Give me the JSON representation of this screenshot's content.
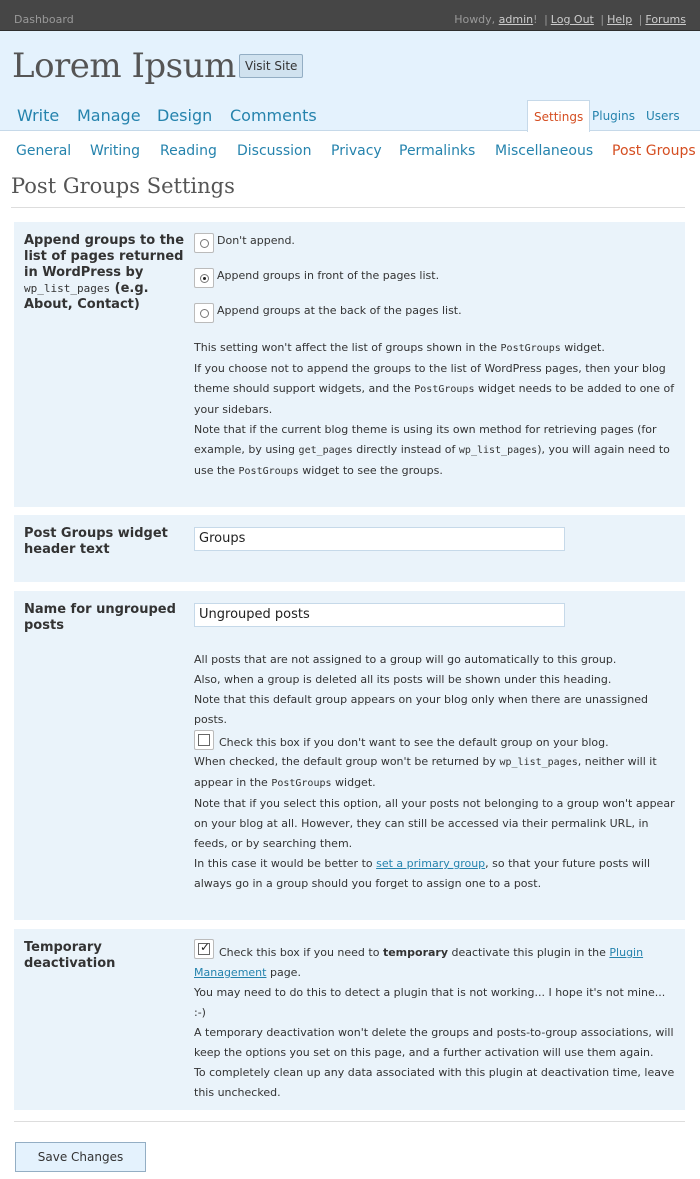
{
  "topbar": {
    "dashboard": "Dashboard",
    "howdy": "Howdy, ",
    "user": "admin",
    "bang": "!",
    "logout": "Log Out",
    "help": "Help",
    "forums": "Forums",
    "sep": "|"
  },
  "header": {
    "site_title": "Lorem Ipsum",
    "visit_site": "Visit Site",
    "main_nav": [
      "Write",
      "Manage",
      "Design",
      "Comments"
    ],
    "right_tabs": [
      "Settings",
      "Plugins",
      "Users"
    ]
  },
  "subnav": [
    "General",
    "Writing",
    "Reading",
    "Discussion",
    "Privacy",
    "Permalinks",
    "Miscellaneous",
    "Post Groups"
  ],
  "page_title": "Post Groups Settings",
  "append": {
    "label_1": "Append groups to the list of pages returned in WordPress by",
    "label_code": "wp_list_pages",
    "label_2": "(e.g. About, Contact)",
    "options": [
      "Don't append.",
      "Append groups in front of the pages list.",
      "Append groups at the back of the pages list."
    ],
    "selected_index": 1,
    "p1a": "This setting won't affect the list of groups shown in the ",
    "code_postgroups": "PostGroups",
    "p1b": " widget.",
    "p2a": "If you choose not to append the groups to the list of WordPress pages, then your blog theme should support widgets, and the ",
    "p2b": " widget needs to be added to one of your sidebars.",
    "p3a": "Note that if the current blog theme is using its own method for retrieving pages (for example, by using ",
    "code_get_pages": "get_pages",
    "p3b": " directly instead of ",
    "code_wp_list_pages": "wp_list_pages",
    "p3c": "), you will again need to use the ",
    "p3d": " widget to see the groups."
  },
  "widget": {
    "label": "Post Groups widget header text",
    "value": "Groups"
  },
  "ungrouped": {
    "label": "Name for ungrouped posts",
    "value": "Ungrouped posts",
    "p1": "All posts that are not assigned to a group will go automatically to this group.",
    "p2": "Also, when a group is deleted all its posts will be shown under this heading.",
    "p3": "Note that this default group appears on your blog only when there are unassigned posts.",
    "checkbox_label": "Check this box if you don't want to see the default group on your blog.",
    "checked": false,
    "p4a": "When checked, the default group won't be returned by ",
    "code_wp_list_pages": "wp_list_pages",
    "p4b": ", neither will it appear in the ",
    "code_postgroups": "PostGroups",
    "p4c": " widget.",
    "p5": "Note that if you select this option, all your posts not belonging to a group won't appear on your blog at all. However, they can still be accessed via their permalink URL, in feeds, or by searching them.",
    "p6a": "In this case it would be better to ",
    "p6_link": "set a primary group",
    "p6b": ", so that your future posts will always go in a group should you forget to assign one to a post."
  },
  "deactivation": {
    "label": "Temporary deactivation",
    "checked": true,
    "c1": "Check this box if you need to ",
    "c_bold": "temporary",
    "c2": " deactivate this plugin in the ",
    "c_link": "Plugin Management",
    "c3": " page.",
    "p1": "You may need to do this to detect a plugin that is not working... I hope it's not mine... :-)",
    "p2": "A temporary deactivation won't delete the groups and posts-to-group associations, will keep the options you set on this page, and a further activation will use them again.",
    "p3": "To completely clean up any data associated with this plugin at deactivation time, leave this unchecked."
  },
  "save_button": "Save Changes",
  "colors": {
    "accent": "#2583ad",
    "current": "#d54e21",
    "header_bg": "#e4f2fd",
    "topbar_bg": "#464646",
    "section_bg": "#eaf3fa"
  }
}
